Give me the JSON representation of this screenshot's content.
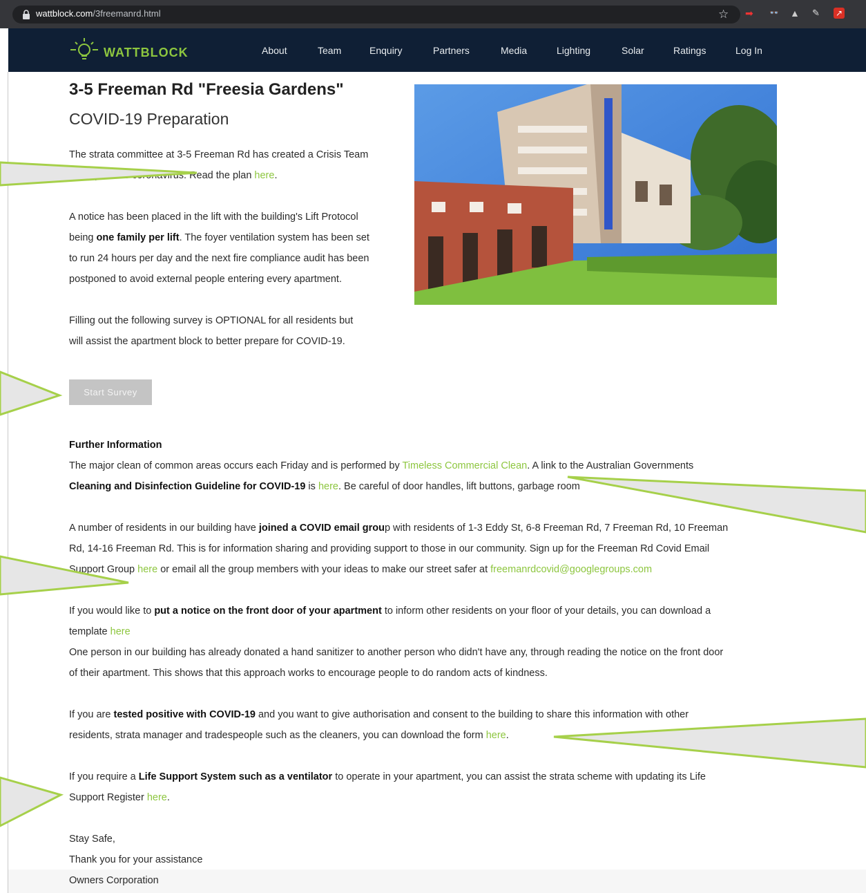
{
  "browser": {
    "url_domain": "wattblock.com",
    "url_path": "/3freemanrd.html"
  },
  "site": {
    "logo_text": "WATTBLOCK",
    "nav": [
      "About",
      "Team",
      "Enquiry",
      "Partners",
      "Media",
      "Lighting",
      "Solar",
      "Ratings",
      "Log In"
    ]
  },
  "page": {
    "title": "3-5 Freeman Rd \"Freesia Gardens\"",
    "subtitle": "COVID-19 Preparation",
    "p1": {
      "line1": "The strata committee at 3-5 Freeman Rd has created a Crisis Team",
      "line2_text": "to prepare for coronavirus. Read the plan ",
      "line2_link": "here",
      "line2_end": "."
    },
    "p2": {
      "a": "A notice has been placed in the lift with the building's Lift Protocol",
      "b_pre": "being ",
      "b_bold": "one family per lift",
      "b_post": ". The foyer ventilation system has been set",
      "c": "to run 24 hours per day and the next fire compliance audit has been",
      "d": "postponed to avoid external people entering every apartment."
    },
    "p3": {
      "a": "Filling out the following survey is OPTIONAL for all residents but",
      "b": "will assist the apartment block to better prepare for COVID-19."
    },
    "survey_button": "Start Survey",
    "further": {
      "heading": "Further Information",
      "a_pre": "The major clean of common areas occurs each Friday and is performed by ",
      "a_link": "Timeless Commercial Clean",
      "a_post": ". A link to the Australian Governments",
      "b_bold": "Cleaning and Disinfection Guideline for COVID-19",
      "b_mid": " is ",
      "b_link": "here",
      "b_post": ".  Be careful of door handles, lift buttons, garbage room "
    },
    "email_group": {
      "a_pre": "A number of residents in our building have ",
      "a_bold": "joined a COVID email grou",
      "a_post": "p with residents of 1-3 Eddy St, 6-8 Freeman Rd, 7 Freeman Rd, 10 Freeman",
      "b": "Rd, 14-16 Freeman Rd. This is for information sharing and providing support to those in our community. Sign up for the Freeman Rd Covid Email",
      "c_pre": "Support Group ",
      "c_link": "here",
      "c_mid": " or email all the group members with your ideas to make our street safer at ",
      "c_email": "freemanrdcovid@googlegroups.com"
    },
    "notice": {
      "a_pre": "If you would like to ",
      "a_bold": "put a notice on the front door of your apartment",
      "a_post": " to inform other residents on your floor of your details, you can download a",
      "b_pre": "template ",
      "b_link": "here",
      "c": "One person in our building has already donated a hand sanitizer to another person who didn't have any, through reading the notice on the front door",
      "d": "of their apartment. This shows that this approach works to encourage people to do random acts of kindness."
    },
    "positive": {
      "a_pre": "If you are ",
      "a_bold": "tested positive with COVID-19",
      "a_post": " and you want to give authorisation and consent to the building to share this information with other",
      "b_pre": "residents, strata manager and tradespeople such as the cleaners, you can download the form ",
      "b_link": "here",
      "b_end": "."
    },
    "life_support": {
      "a_pre": "If you require a ",
      "a_bold": "Life Support System such as a ventilator",
      "a_post": " to operate in your apartment, you can assist the strata scheme with updating its Life",
      "b_pre": "Support Register ",
      "b_link": "here",
      "b_end": "."
    },
    "signoff": [
      "Stay Safe,",
      "Thank you for your assistance",
      "Owners Corporation"
    ]
  },
  "colors": {
    "nav_bg": "#0f1f35",
    "accent": "#8dc63f",
    "callout_fill": "#e6e6e6",
    "callout_stroke": "#a6d04a"
  }
}
